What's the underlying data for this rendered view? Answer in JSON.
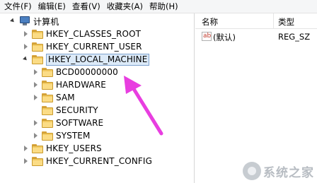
{
  "menubar": {
    "items": [
      "文件(F)",
      "编辑(E)",
      "查看(V)",
      "收藏夹(A)",
      "帮助(H)"
    ]
  },
  "tree": {
    "root": "计算机",
    "nodes": [
      {
        "label": "HKEY_CLASSES_ROOT",
        "state": "collapsed"
      },
      {
        "label": "HKEY_CURRENT_USER",
        "state": "collapsed"
      },
      {
        "label": "HKEY_LOCAL_MACHINE",
        "state": "expanded",
        "selected": true
      },
      {
        "label": "BCD00000000",
        "state": "collapsed",
        "child": true
      },
      {
        "label": "HARDWARE",
        "state": "collapsed",
        "child": true
      },
      {
        "label": "SAM",
        "state": "collapsed",
        "child": true
      },
      {
        "label": "SECURITY",
        "state": "leaf",
        "child": true
      },
      {
        "label": "SOFTWARE",
        "state": "collapsed",
        "child": true
      },
      {
        "label": "SYSTEM",
        "state": "collapsed",
        "child": true
      },
      {
        "label": "HKEY_USERS",
        "state": "collapsed"
      },
      {
        "label": "HKEY_CURRENT_CONFIG",
        "state": "collapsed"
      }
    ]
  },
  "values_pane": {
    "columns": {
      "name": "名称",
      "type": "类型"
    },
    "rows": [
      {
        "name": "(默认)",
        "type": "REG_SZ",
        "icon": "ab-string-icon"
      }
    ]
  },
  "annotation": {
    "color": "#e83ee0",
    "icon": "pointer-arrow"
  },
  "watermark": {
    "text": "系统之家",
    "icon": "logo-icon"
  }
}
